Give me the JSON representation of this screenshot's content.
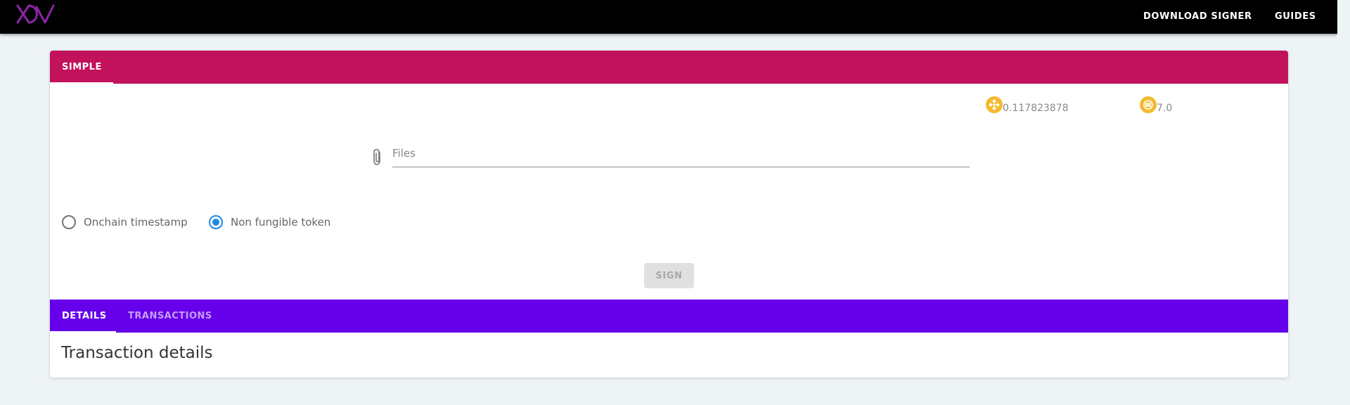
{
  "header": {
    "logo_text": "XDV",
    "nav": [
      {
        "label": "DOWNLOAD SIGNER"
      },
      {
        "label": "GUIDES"
      }
    ]
  },
  "top_tabs": [
    {
      "label": "SIMPLE",
      "active": true
    }
  ],
  "balances": [
    {
      "icon": "bnb-coin-icon",
      "value": "0.117823878"
    },
    {
      "icon": "busd-coin-icon",
      "value": "7.0"
    }
  ],
  "files_input": {
    "placeholder": "Files",
    "value": ""
  },
  "mode_options": [
    {
      "label": "Onchain timestamp",
      "checked": false
    },
    {
      "label": "Non fungible token",
      "checked": true
    }
  ],
  "sign_button": {
    "label": "SIGN",
    "disabled": true
  },
  "bottom_tabs": [
    {
      "label": "DETAILS",
      "active": true
    },
    {
      "label": "TRANSACTIONS",
      "active": false
    }
  ],
  "details": {
    "title": "Transaction details"
  },
  "colors": {
    "appbar": "#000000",
    "top_tabbar": "#c2125c",
    "bottom_tabbar": "#6600ea",
    "coin": "#f3ba2f",
    "radio_accent": "#1e88e5",
    "logo": "#8e24aa"
  }
}
